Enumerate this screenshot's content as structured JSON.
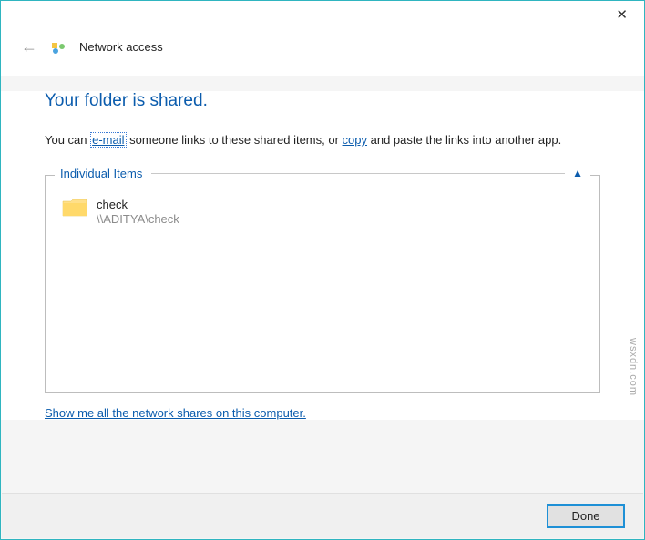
{
  "window": {
    "title": "Network access",
    "close_label": "✕"
  },
  "heading": "Your folder is shared.",
  "description": {
    "prefix": "You can ",
    "email_link": "e-mail",
    "middle": " someone links to these shared items, or ",
    "copy_link": "copy",
    "suffix": " and paste the links into another app."
  },
  "group": {
    "title": "Individual Items",
    "chevron": "▲"
  },
  "item": {
    "name": "check",
    "path": "\\\\ADITYA\\check"
  },
  "all_shares_link": "Show me all the network shares on this computer.",
  "footer": {
    "done_label": "Done"
  },
  "watermark": "wsxdn.com"
}
